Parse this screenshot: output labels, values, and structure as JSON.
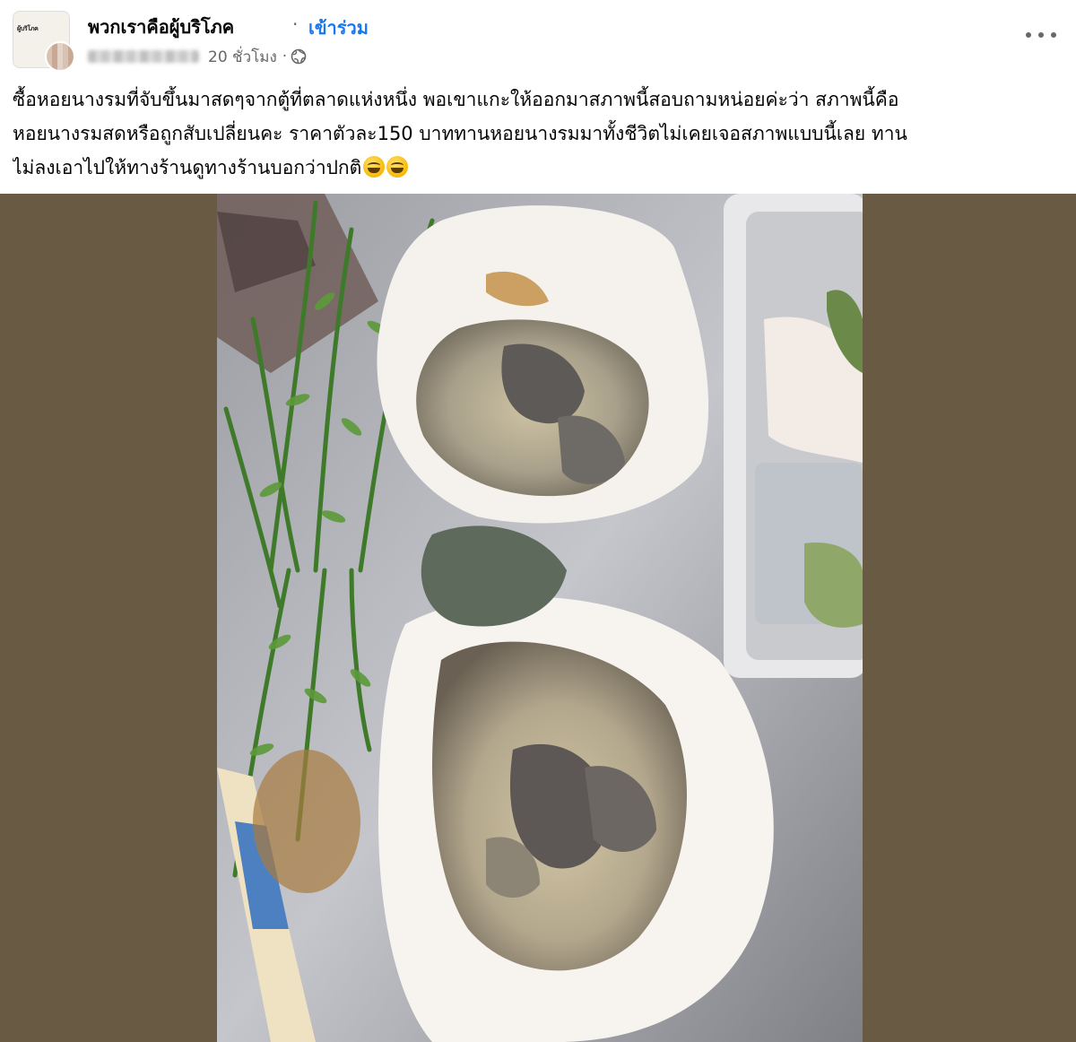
{
  "post": {
    "group_name": "พวกเราคือผู้บริโภค",
    "join_label": "เข้าร่วม",
    "separator": "·",
    "time_label": "20 ชั่วโมง",
    "avatar_logo_text": "ผู้บริโภค",
    "text_lines": [
      "ซื้อหอยนางรมที่จับขึ้นมาสดๆจากตู้ที่ตลาดแห่งหนึ่ง พอเขาแกะให้ออกมาสภาพนี้สอบถามหน่อยค่ะว่า สภาพนี้คือ",
      "หอยนางรมสดหรือถูกสับเปลี่ยนคะ ราคาตัวละ150 บาททานหอยนางรมมาทั้งชีวิตไม่เคยเจอสภาพแบบนี้เลย ทาน",
      "ไม่ลงเอาไปให้ทางร้านดูทางร้านบอกว่าปกติ"
    ],
    "emojis": [
      "grinning-sweat-emoji",
      "grinning-sweat-emoji"
    ]
  },
  "icons": {
    "globe": "globe-icon",
    "more": "more-options-icon"
  },
  "colors": {
    "link_blue": "#1877f2",
    "secondary_text": "#65676b",
    "photo_backdrop": "#695a43"
  },
  "photo": {
    "subject": "oysters-on-foil"
  }
}
